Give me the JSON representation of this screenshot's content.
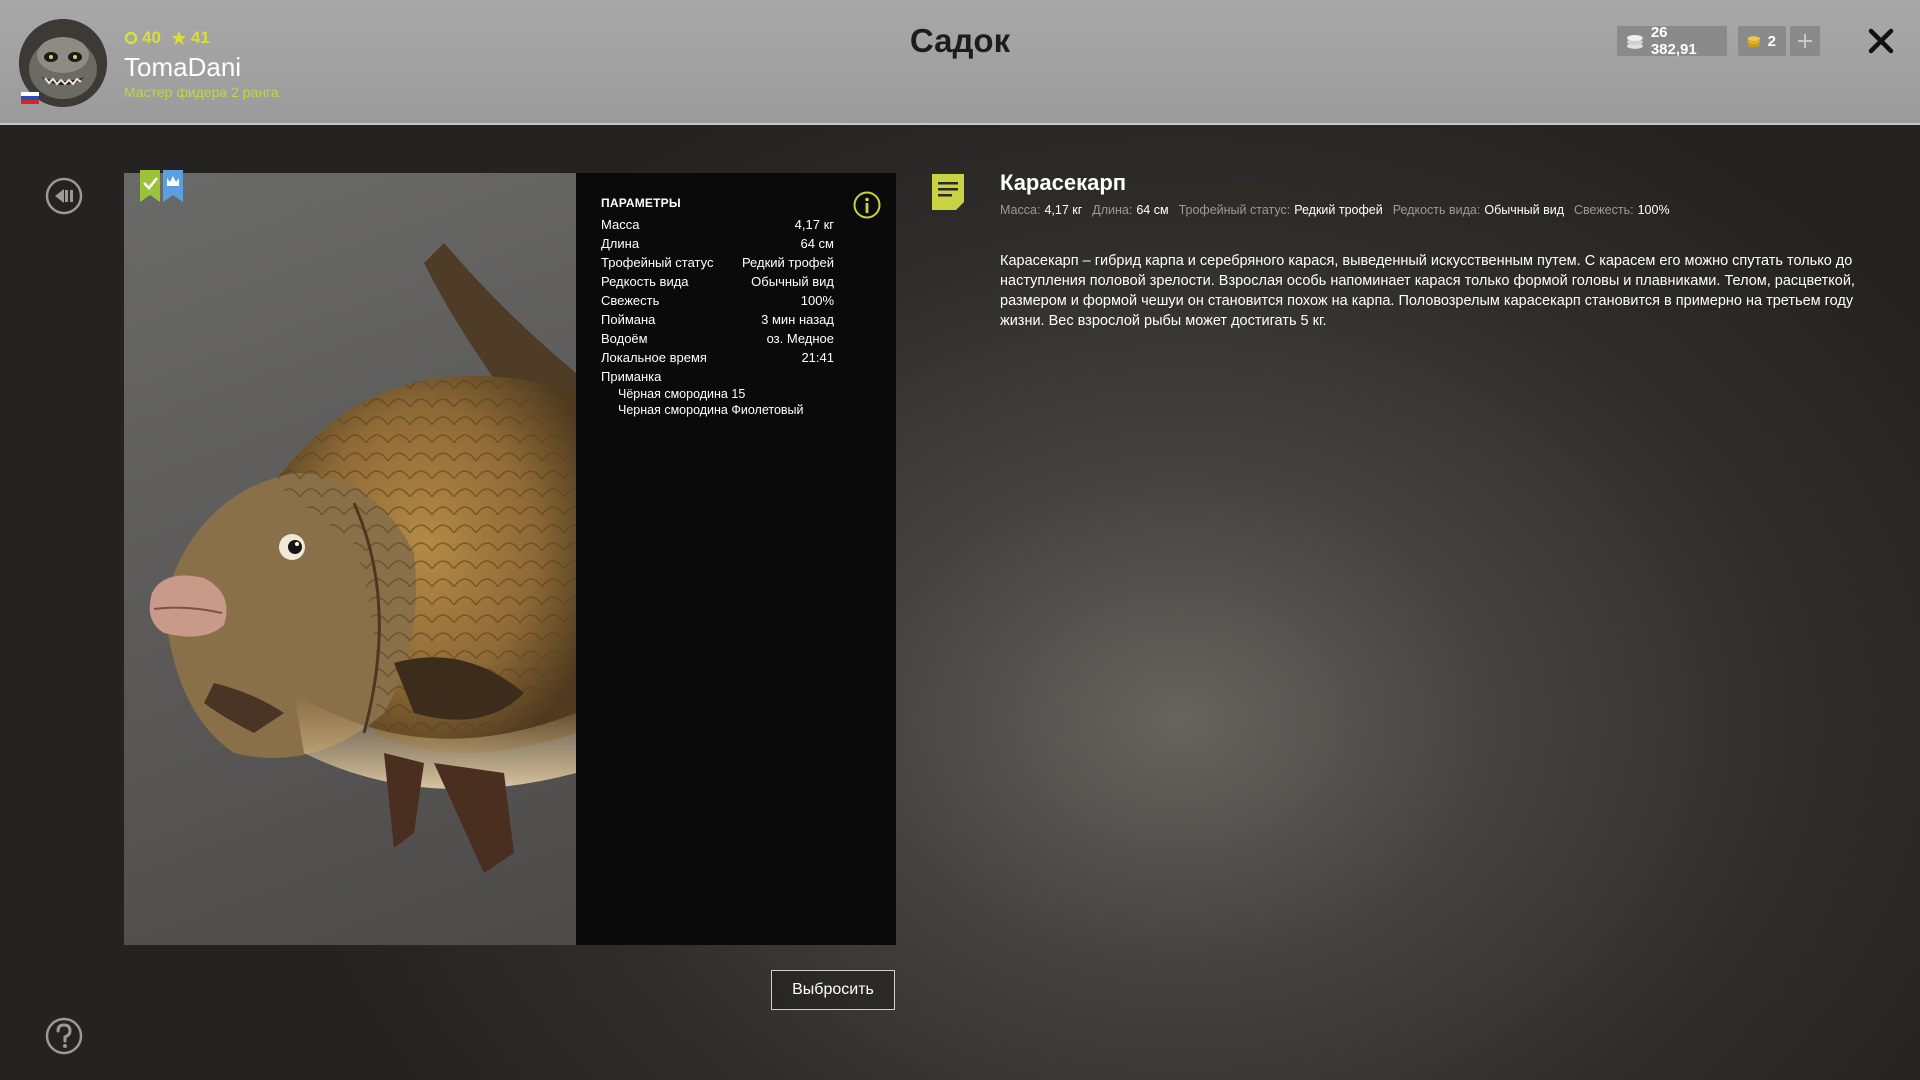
{
  "header": {
    "title": "Садок",
    "player": {
      "name": "TomaDani",
      "rank": "Мастер фидера 2 ранга",
      "level": "40",
      "stars": "41"
    },
    "currency": {
      "silver": "26 382,91",
      "gold": "2"
    }
  },
  "params": {
    "title": "ПАРАМЕТРЫ",
    "rows": [
      {
        "label": "Масса",
        "value": "4,17 кг"
      },
      {
        "label": "Длина",
        "value": "64 см"
      },
      {
        "label": "Трофейный статус",
        "value": "Редкий трофей"
      },
      {
        "label": "Редкость вида",
        "value": "Обычный вид"
      },
      {
        "label": "Свежесть",
        "value": "100%"
      },
      {
        "label": "Поймана",
        "value": "3 мин назад"
      },
      {
        "label": "Водоём",
        "value": "оз. Медное"
      },
      {
        "label": "Локальное время",
        "value": "21:41"
      }
    ],
    "bait_label": "Приманка",
    "baits": [
      "Чёрная смородина 15",
      "Черная смородина Фиолетовый"
    ]
  },
  "actions": {
    "discard": "Выбросить"
  },
  "fish": {
    "name": "Карасекарп",
    "summary": [
      {
        "k": "Масса:",
        "v": "4,17 кг"
      },
      {
        "k": "Длина:",
        "v": "64 см"
      },
      {
        "k": "Трофейный статус:",
        "v": "Редкий трофей"
      },
      {
        "k": "Редкость вида:",
        "v": "Обычный вид"
      },
      {
        "k": "Свежесть:",
        "v": "100%"
      }
    ],
    "description": "Карасекарп – гибрид карпа и серебряного карася, выведенный искусственным путем. С карасем его можно спутать только до наступления половой зрелости. Взрослая особь напоминает карася только формой головы и плавниками. Телом, расцветкой, размером и формой чешуи он становится похож на карпа. Половозрелым карасекарп становится в примерно на третьем году жизни. Вес взрослой рыбы может достигать 5 кг."
  },
  "icons": {
    "back": "back-icon",
    "help": "help-icon",
    "info": "info-icon",
    "close": "close-icon",
    "doc": "document-icon"
  },
  "colors": {
    "accent": "#c9d243",
    "header_bg": "#a0a0a0",
    "panel_bg": "#0a0a0a"
  }
}
